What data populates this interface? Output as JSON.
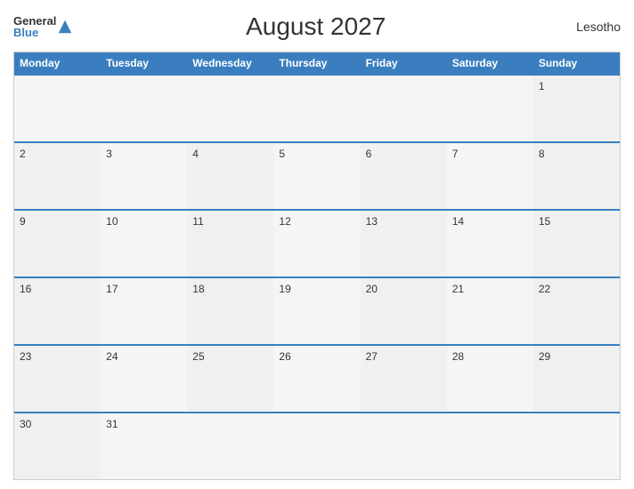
{
  "header": {
    "title": "August 2027",
    "country": "Lesotho",
    "logo": {
      "general": "General",
      "blue": "Blue"
    }
  },
  "days_of_week": [
    "Monday",
    "Tuesday",
    "Wednesday",
    "Thursday",
    "Friday",
    "Saturday",
    "Sunday"
  ],
  "weeks": [
    [
      null,
      null,
      null,
      null,
      null,
      null,
      1
    ],
    [
      2,
      3,
      4,
      5,
      6,
      7,
      8
    ],
    [
      9,
      10,
      11,
      12,
      13,
      14,
      15
    ],
    [
      16,
      17,
      18,
      19,
      20,
      21,
      22
    ],
    [
      23,
      24,
      25,
      26,
      27,
      28,
      29
    ],
    [
      30,
      31,
      null,
      null,
      null,
      null,
      null
    ]
  ]
}
